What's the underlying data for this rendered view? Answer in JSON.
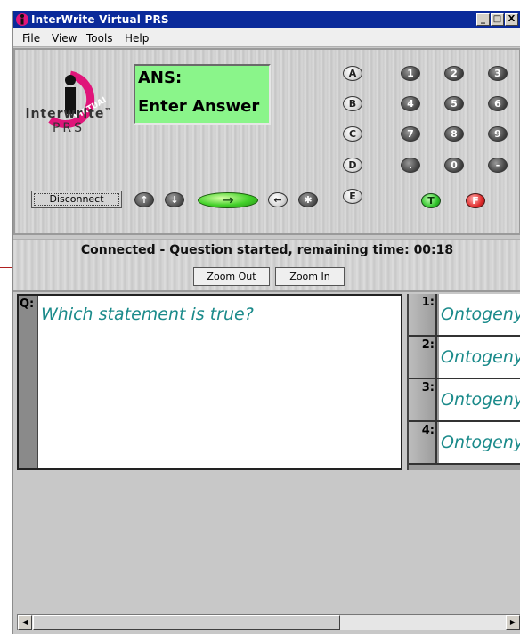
{
  "window": {
    "title": "InterWrite Virtual PRS",
    "controls": {
      "minimize": "_",
      "maximize": "□",
      "close": "X"
    }
  },
  "menu": {
    "items": [
      "File",
      "View",
      "Tools",
      "Help"
    ]
  },
  "device": {
    "logo": {
      "brand": "interwrite",
      "tm": "™",
      "product": "PRS",
      "badge": "VIRTUAL"
    },
    "lcd": {
      "line1": "ANS:",
      "line2": "Enter Answer",
      "color": "#8af58a"
    },
    "letter_keys": [
      "A",
      "B",
      "C",
      "D",
      "E"
    ],
    "number_keys": [
      "1",
      "2",
      "3",
      "4",
      "5",
      "6",
      "7",
      "8",
      "9",
      ".",
      "0",
      "-"
    ],
    "disconnect_label": "Disconnect",
    "nav_buttons": {
      "up": "↑",
      "down": "↓",
      "enter": "→",
      "back": "←",
      "star": "✱"
    },
    "true_label": "T",
    "false_label": "F"
  },
  "status": {
    "text": "Connected - Question started, remaining time: 00:18",
    "zoom_out": "Zoom Out",
    "zoom_in": "Zoom In"
  },
  "question": {
    "label": "Q:",
    "text": "Which statement is true?"
  },
  "answers": [
    {
      "num": "1:",
      "text": "Ontogeny"
    },
    {
      "num": "2:",
      "text": "Ontogeny"
    },
    {
      "num": "3:",
      "text": "Ontogeny"
    },
    {
      "num": "4:",
      "text": "Ontogeny"
    }
  ],
  "scrollbar": {
    "left": "◀",
    "right": "▶"
  }
}
